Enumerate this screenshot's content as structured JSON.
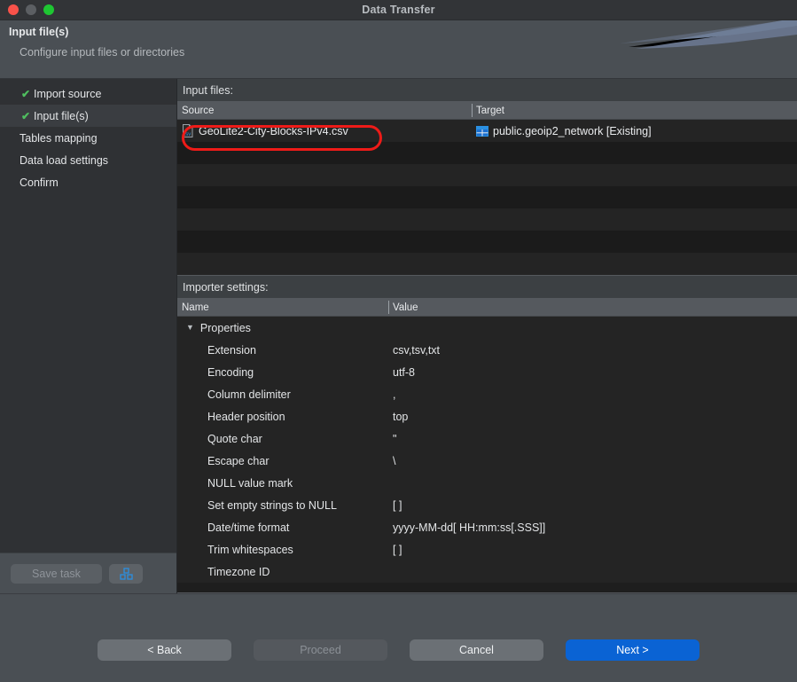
{
  "window": {
    "title": "Data Transfer",
    "traffic_lights": [
      "close-red",
      "minimize-grey",
      "maximize-green"
    ]
  },
  "header": {
    "title": "Input file(s)",
    "subtitle": "Configure input files or directories"
  },
  "sidebar": {
    "steps": [
      {
        "label": "Import source",
        "done": true,
        "active": false
      },
      {
        "label": "Input file(s)",
        "done": true,
        "active": true
      },
      {
        "label": "Tables mapping",
        "done": false,
        "active": false
      },
      {
        "label": "Data load settings",
        "done": false,
        "active": false
      },
      {
        "label": "Confirm",
        "done": false,
        "active": false
      }
    ],
    "check_glyph": "✔",
    "save_task_label": "Save task",
    "task_icon_name": "blocks-icon"
  },
  "main": {
    "input_files_label": "Input files:",
    "files_table": {
      "columns": [
        "Source",
        "Target"
      ],
      "rows": [
        {
          "source": "GeoLite2-City-Blocks-IPv4.csv",
          "target": "public.geoip2_network [Existing]"
        },
        {
          "source": "",
          "target": ""
        },
        {
          "source": "",
          "target": ""
        },
        {
          "source": "",
          "target": ""
        },
        {
          "source": "",
          "target": ""
        },
        {
          "source": "",
          "target": ""
        },
        {
          "source": "",
          "target": ""
        }
      ]
    },
    "importer_settings_label": "Importer settings:",
    "settings_table": {
      "columns": [
        "Name",
        "Value"
      ],
      "group_label": "Properties",
      "group_expanded": true,
      "rows": [
        {
          "name": "Extension",
          "value": "csv,tsv,txt"
        },
        {
          "name": "Encoding",
          "value": "utf-8"
        },
        {
          "name": "Column delimiter",
          "value": ","
        },
        {
          "name": "Header position",
          "value": "top"
        },
        {
          "name": "Quote char",
          "value": "\""
        },
        {
          "name": "Escape char",
          "value": "\\"
        },
        {
          "name": "NULL value mark",
          "value": ""
        },
        {
          "name": "Set empty strings to NULL",
          "value": "[ ]"
        },
        {
          "name": "Date/time format",
          "value": "yyyy-MM-dd[ HH:mm:ss[.SSS]]"
        },
        {
          "name": "Trim whitespaces",
          "value": "[ ]"
        },
        {
          "name": "Timezone ID",
          "value": ""
        }
      ]
    }
  },
  "footer": {
    "back_label": "< Back",
    "proceed_label": "Proceed",
    "cancel_label": "Cancel",
    "next_label": "Next >"
  },
  "annotation": {
    "color": "#ee1b18",
    "target": "GeoLite2-City-Blocks-IPv4.csv"
  },
  "colors": {
    "accent_blue": "#0a63d4",
    "check_green": "#4fbf5f",
    "annotation_red": "#ee1b18",
    "window_bg": "#4a4f54",
    "table_bg": "#1e1e1e"
  }
}
